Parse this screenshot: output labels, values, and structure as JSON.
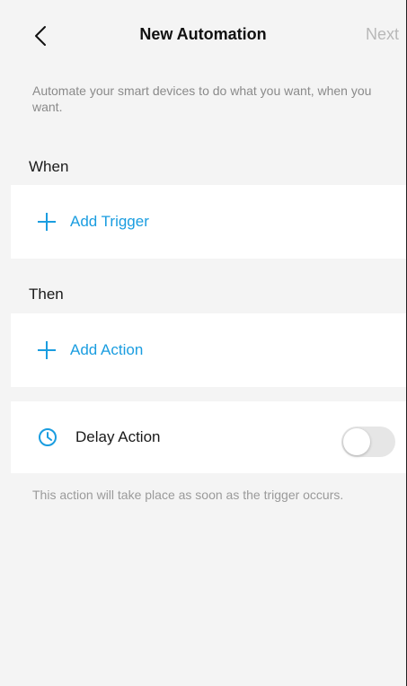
{
  "header": {
    "title": "New Automation",
    "next_label": "Next"
  },
  "intro": {
    "text": "Automate your smart devices to do what you want, when you want."
  },
  "when_section": {
    "label": "When",
    "add_label": "Add Trigger"
  },
  "then_section": {
    "label": "Then",
    "add_label": "Add Action"
  },
  "delay": {
    "label": "Delay Action",
    "enabled": false,
    "note": "This action will take place as soon as the trigger occurs."
  },
  "colors": {
    "accent": "#1a9de0",
    "background": "#f4f4f4",
    "card": "#ffffff",
    "muted_text": "#8a8a8a",
    "disabled_text": "#b8b8b8"
  }
}
